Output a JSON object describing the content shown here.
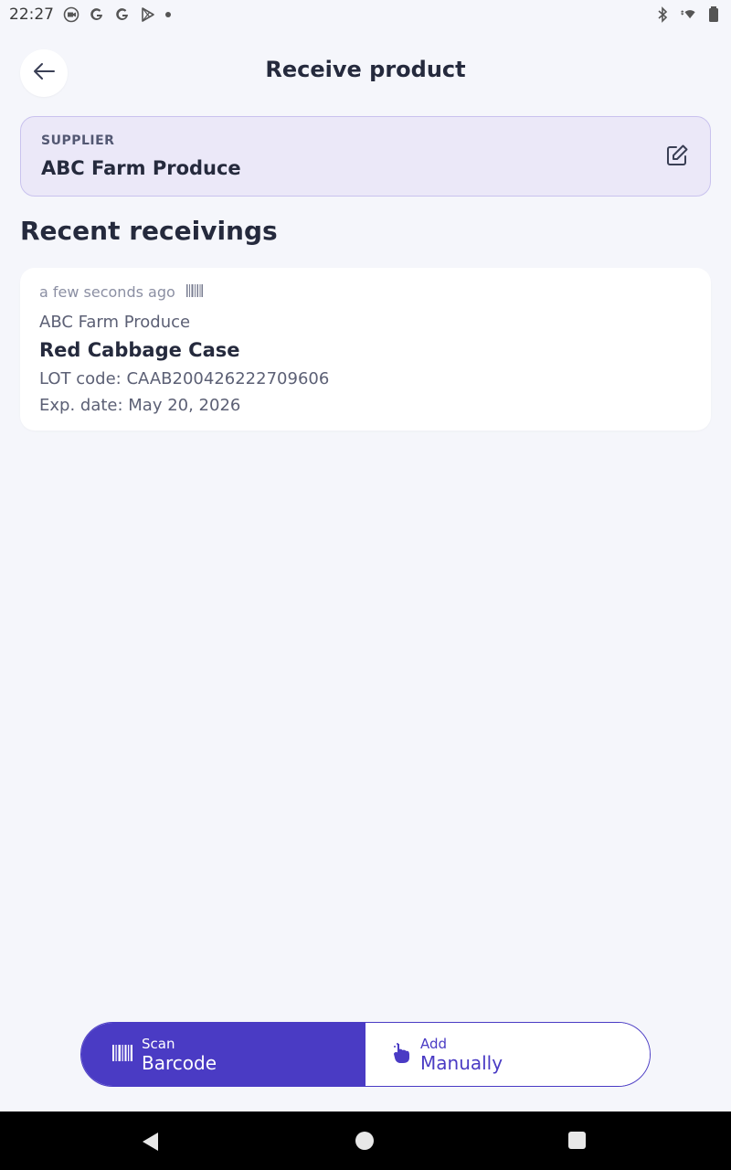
{
  "status_bar": {
    "time": "22:27",
    "left_icons": [
      "camera-badge-icon",
      "google-icon",
      "google-icon",
      "play-store-icon",
      "dot-icon"
    ],
    "right_icons": [
      "bluetooth-icon",
      "wifi-icon",
      "battery-icon"
    ]
  },
  "header": {
    "title": "Receive product",
    "back_icon": "arrow-left-icon"
  },
  "supplier": {
    "label": "SUPPLIER",
    "name": "ABC Farm Produce",
    "edit_icon": "edit-icon"
  },
  "recent": {
    "title": "Recent receivings",
    "items": [
      {
        "time": "a few seconds ago",
        "source_icon": "barcode-icon",
        "supplier": "ABC Farm Produce",
        "product": "Red Cabbage Case",
        "lot": "LOT code: CAAB200426222709606",
        "exp": "Exp. date: May 20, 2026"
      }
    ]
  },
  "actions": {
    "scan": {
      "small": "Scan",
      "large": "Barcode",
      "icon": "barcode-icon"
    },
    "manual": {
      "small": "Add",
      "large": "Manually",
      "icon": "hand-pointer-icon"
    }
  },
  "colors": {
    "accent": "#4a3bc4",
    "background": "#f5f6fb",
    "supplier_bg": "#ebe8f8"
  }
}
